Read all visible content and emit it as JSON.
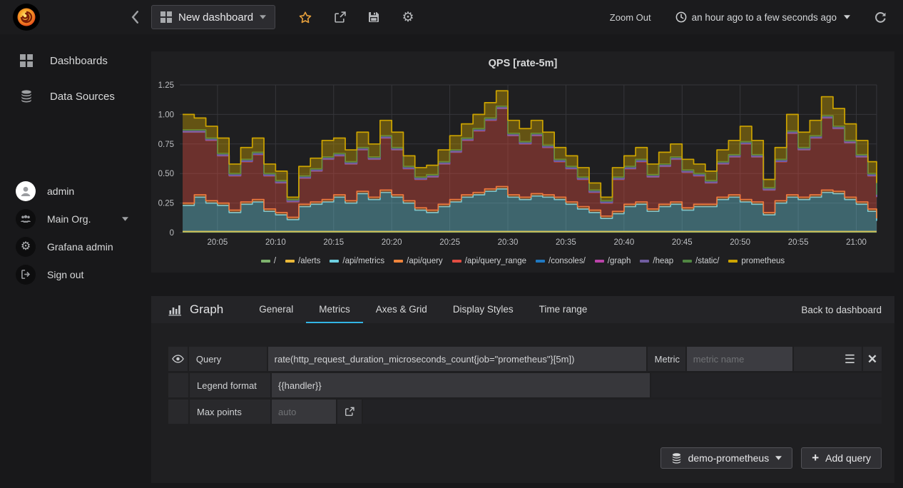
{
  "colors": {
    "accent_tab": "#33b5e5",
    "star": "#e9a13c",
    "panel_bg": "#1f1f21",
    "page_bg": "#18181a"
  },
  "navbar": {
    "dashboard_button": {
      "label": "New dashboard",
      "icon": "dashboard-grid-icon"
    },
    "action_icons": [
      "star-icon",
      "share-icon",
      "save-icon",
      "gear-icon"
    ],
    "zoom_out_label": "Zoom Out",
    "time_range_label": "an hour ago to a few seconds ago",
    "refresh_icon": "refresh-icon"
  },
  "sidebar": {
    "items": [
      {
        "label": "Dashboards",
        "icon": "dashboards-grid-icon"
      },
      {
        "label": "Data Sources",
        "icon": "database-icon"
      }
    ],
    "user_items": [
      {
        "label": "admin",
        "icon": "avatar-icon"
      },
      {
        "label": "Main Org.",
        "icon": "users-icon",
        "has_caret": true
      },
      {
        "label": "Grafana admin",
        "icon": "gear-icon"
      },
      {
        "label": "Sign out",
        "icon": "sign-out-icon"
      }
    ]
  },
  "chart_data": {
    "type": "area",
    "stacked": true,
    "steps": true,
    "title": "QPS [rate-5m]",
    "ylabel": "",
    "xlabel": "",
    "ylim": [
      0,
      1.25
    ],
    "grid": true,
    "legend_position": "bottom",
    "x_axis_start_min": 1.75,
    "x_axis_end_min": 61.75,
    "x_start_min": 2,
    "x_interval_min": 1,
    "y_ticks": [
      {
        "v": 0,
        "label": "0"
      },
      {
        "v": 0.25,
        "label": "0.25"
      },
      {
        "v": 0.5,
        "label": "0.50"
      },
      {
        "v": 0.75,
        "label": "0.75"
      },
      {
        "v": 1.0,
        "label": "1.00"
      },
      {
        "v": 1.25,
        "label": "1.25"
      }
    ],
    "x_ticks": [
      {
        "min": 5,
        "label": "20:05"
      },
      {
        "min": 10,
        "label": "20:10"
      },
      {
        "min": 15,
        "label": "20:15"
      },
      {
        "min": 20,
        "label": "20:20"
      },
      {
        "min": 25,
        "label": "20:25"
      },
      {
        "min": 30,
        "label": "20:30"
      },
      {
        "min": 35,
        "label": "20:35"
      },
      {
        "min": 40,
        "label": "20:40"
      },
      {
        "min": 45,
        "label": "20:45"
      },
      {
        "min": 50,
        "label": "20:50"
      },
      {
        "min": 55,
        "label": "20:55"
      },
      {
        "min": 60,
        "label": "21:00"
      }
    ],
    "series": [
      {
        "name": "/",
        "color": "#7EB26D",
        "flat": 0.005
      },
      {
        "name": "/alerts",
        "color": "#EAB839",
        "flat": 0.005
      },
      {
        "name": "/api/metrics",
        "color": "#6ED0E0",
        "values": [
          0.22,
          0.29,
          0.24,
          0.22,
          0.16,
          0.23,
          0.25,
          0.17,
          0.14,
          0.1,
          0.21,
          0.23,
          0.25,
          0.29,
          0.24,
          0.32,
          0.27,
          0.33,
          0.29,
          0.24,
          0.18,
          0.16,
          0.21,
          0.25,
          0.29,
          0.31,
          0.34,
          0.36,
          0.29,
          0.27,
          0.3,
          0.29,
          0.27,
          0.23,
          0.19,
          0.16,
          0.11,
          0.15,
          0.21,
          0.23,
          0.17,
          0.21,
          0.23,
          0.18,
          0.21,
          0.21,
          0.27,
          0.29,
          0.25,
          0.23,
          0.14,
          0.24,
          0.29,
          0.27,
          0.29,
          0.33,
          0.32,
          0.27,
          0.23,
          0.17,
          0.09
        ]
      },
      {
        "name": "/api/query",
        "color": "#EF843C",
        "flat": 0.02
      },
      {
        "name": "/api/query_range",
        "color": "#E24D42",
        "values": [
          0.6,
          0.53,
          0.51,
          0.4,
          0.29,
          0.34,
          0.38,
          0.28,
          0.25,
          0.13,
          0.22,
          0.26,
          0.34,
          0.33,
          0.31,
          0.35,
          0.32,
          0.44,
          0.38,
          0.27,
          0.24,
          0.28,
          0.34,
          0.4,
          0.46,
          0.52,
          0.58,
          0.66,
          0.5,
          0.45,
          0.49,
          0.4,
          0.3,
          0.28,
          0.23,
          0.15,
          0.11,
          0.27,
          0.3,
          0.34,
          0.27,
          0.32,
          0.36,
          0.3,
          0.24,
          0.18,
          0.28,
          0.32,
          0.47,
          0.38,
          0.19,
          0.33,
          0.52,
          0.4,
          0.48,
          0.61,
          0.53,
          0.46,
          0.38,
          0.28,
          0.18
        ]
      },
      {
        "name": "/consoles/",
        "color": "#1F78C1",
        "flat": 0.003
      },
      {
        "name": "/graph",
        "color": "#BA43A9",
        "flat": 0.003
      },
      {
        "name": "/heap",
        "color": "#705DA0",
        "flat": 0.003
      },
      {
        "name": "/static/",
        "color": "#508642",
        "flat": 0.011
      },
      {
        "name": "prometheus",
        "color": "#CCA300",
        "values": [
          0.13,
          0.1,
          0.1,
          0.13,
          0.08,
          0.1,
          0.12,
          0.08,
          0.08,
          0.02,
          0.08,
          0.09,
          0.14,
          0.13,
          0.1,
          0.13,
          0.11,
          0.13,
          0.13,
          0.09,
          0.08,
          0.08,
          0.1,
          0.12,
          0.12,
          0.12,
          0.13,
          0.13,
          0.11,
          0.11,
          0.11,
          0.11,
          0.1,
          0.09,
          0.08,
          0.06,
          0.03,
          0.08,
          0.09,
          0.1,
          0.09,
          0.1,
          0.11,
          0.09,
          0.08,
          0.08,
          0.1,
          0.12,
          0.13,
          0.12,
          0.07,
          0.1,
          0.14,
          0.13,
          0.13,
          0.16,
          0.15,
          0.14,
          0.12,
          0.1,
          0.1
        ]
      }
    ]
  },
  "editor": {
    "panel_type_label": "Graph",
    "tabs": [
      "General",
      "Metrics",
      "Axes & Grid",
      "Display Styles",
      "Time range"
    ],
    "active_tab": "Metrics",
    "back_label": "Back to dashboard",
    "query_row": {
      "label": "Query",
      "value": "rate(http_request_duration_microseconds_count{job=\"prometheus\"}[5m])",
      "metric_label": "Metric",
      "metric_placeholder": "metric name"
    },
    "legend_row": {
      "label": "Legend format",
      "value": "{{handler}}"
    },
    "max_points_row": {
      "label": "Max points",
      "placeholder": "auto"
    },
    "datasource_button": "demo-prometheus",
    "add_query_button": "Add query"
  }
}
